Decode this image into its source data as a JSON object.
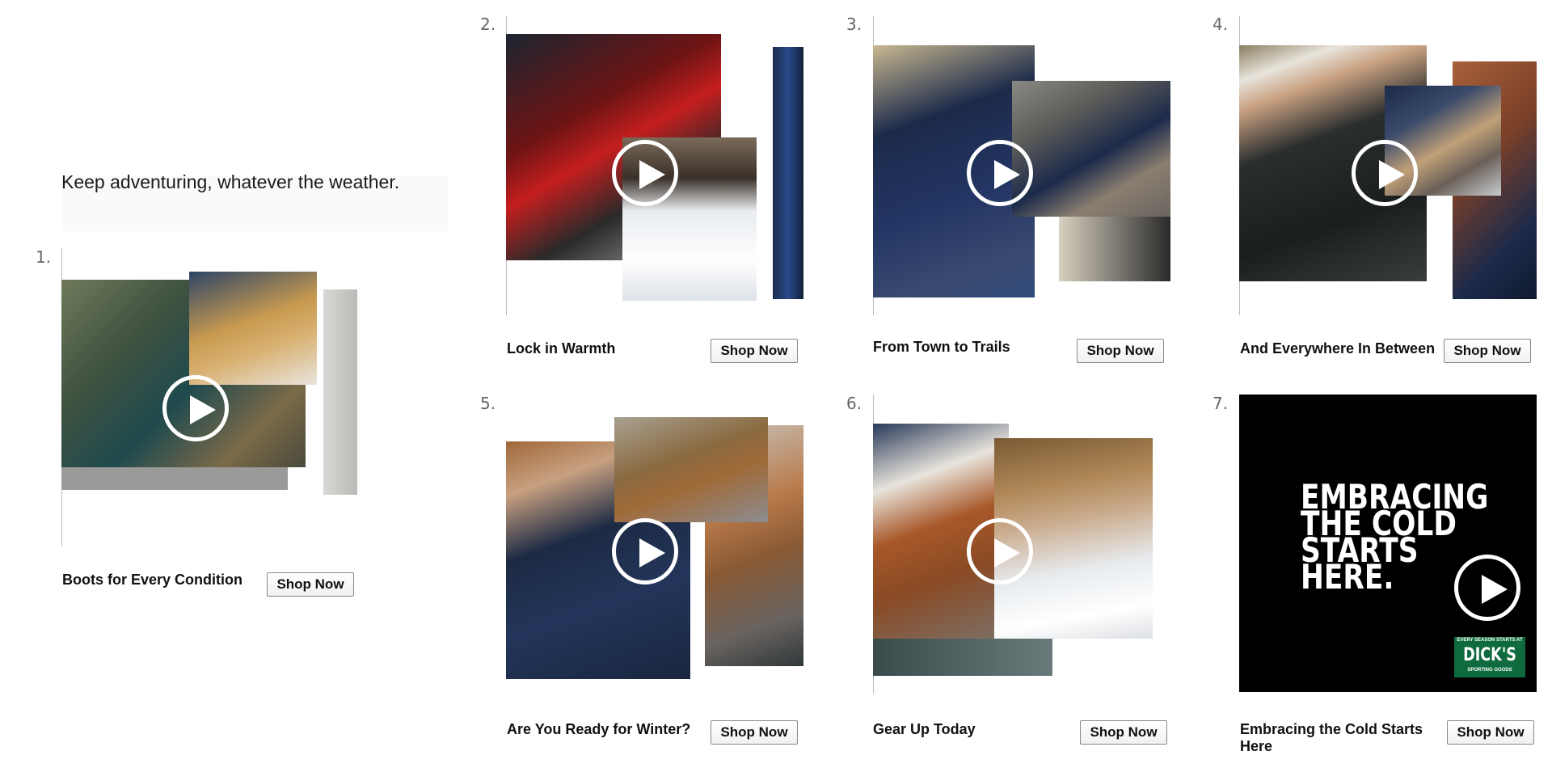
{
  "intro": {
    "tagline": "Keep adventuring, whatever the weather."
  },
  "shop_label": "Shop Now",
  "cards": [
    {
      "number": "1.",
      "title": "Boots for Every Condition"
    },
    {
      "number": "2.",
      "title": "Lock in Warmth"
    },
    {
      "number": "3.",
      "title": "From Town to Trails"
    },
    {
      "number": "4.",
      "title": "And Everywhere In Between"
    },
    {
      "number": "5.",
      "title": "Are You Ready for Winter?"
    },
    {
      "number": "6.",
      "title": "Gear Up Today"
    },
    {
      "number": "7.",
      "title": "Embracing the Cold Starts Here"
    }
  ],
  "promo": {
    "headline": "EMBRACING\nTHE COLD\nSTARTS\nHERE.",
    "logo_tagline": "EVERY SEASON STARTS AT",
    "logo_name": "DICK'S",
    "logo_sub": "SPORTING GOODS"
  },
  "colors": {
    "play_icon": "#ffffff",
    "logo_green": "#0f6b3e",
    "promo_bg": "#000000"
  }
}
